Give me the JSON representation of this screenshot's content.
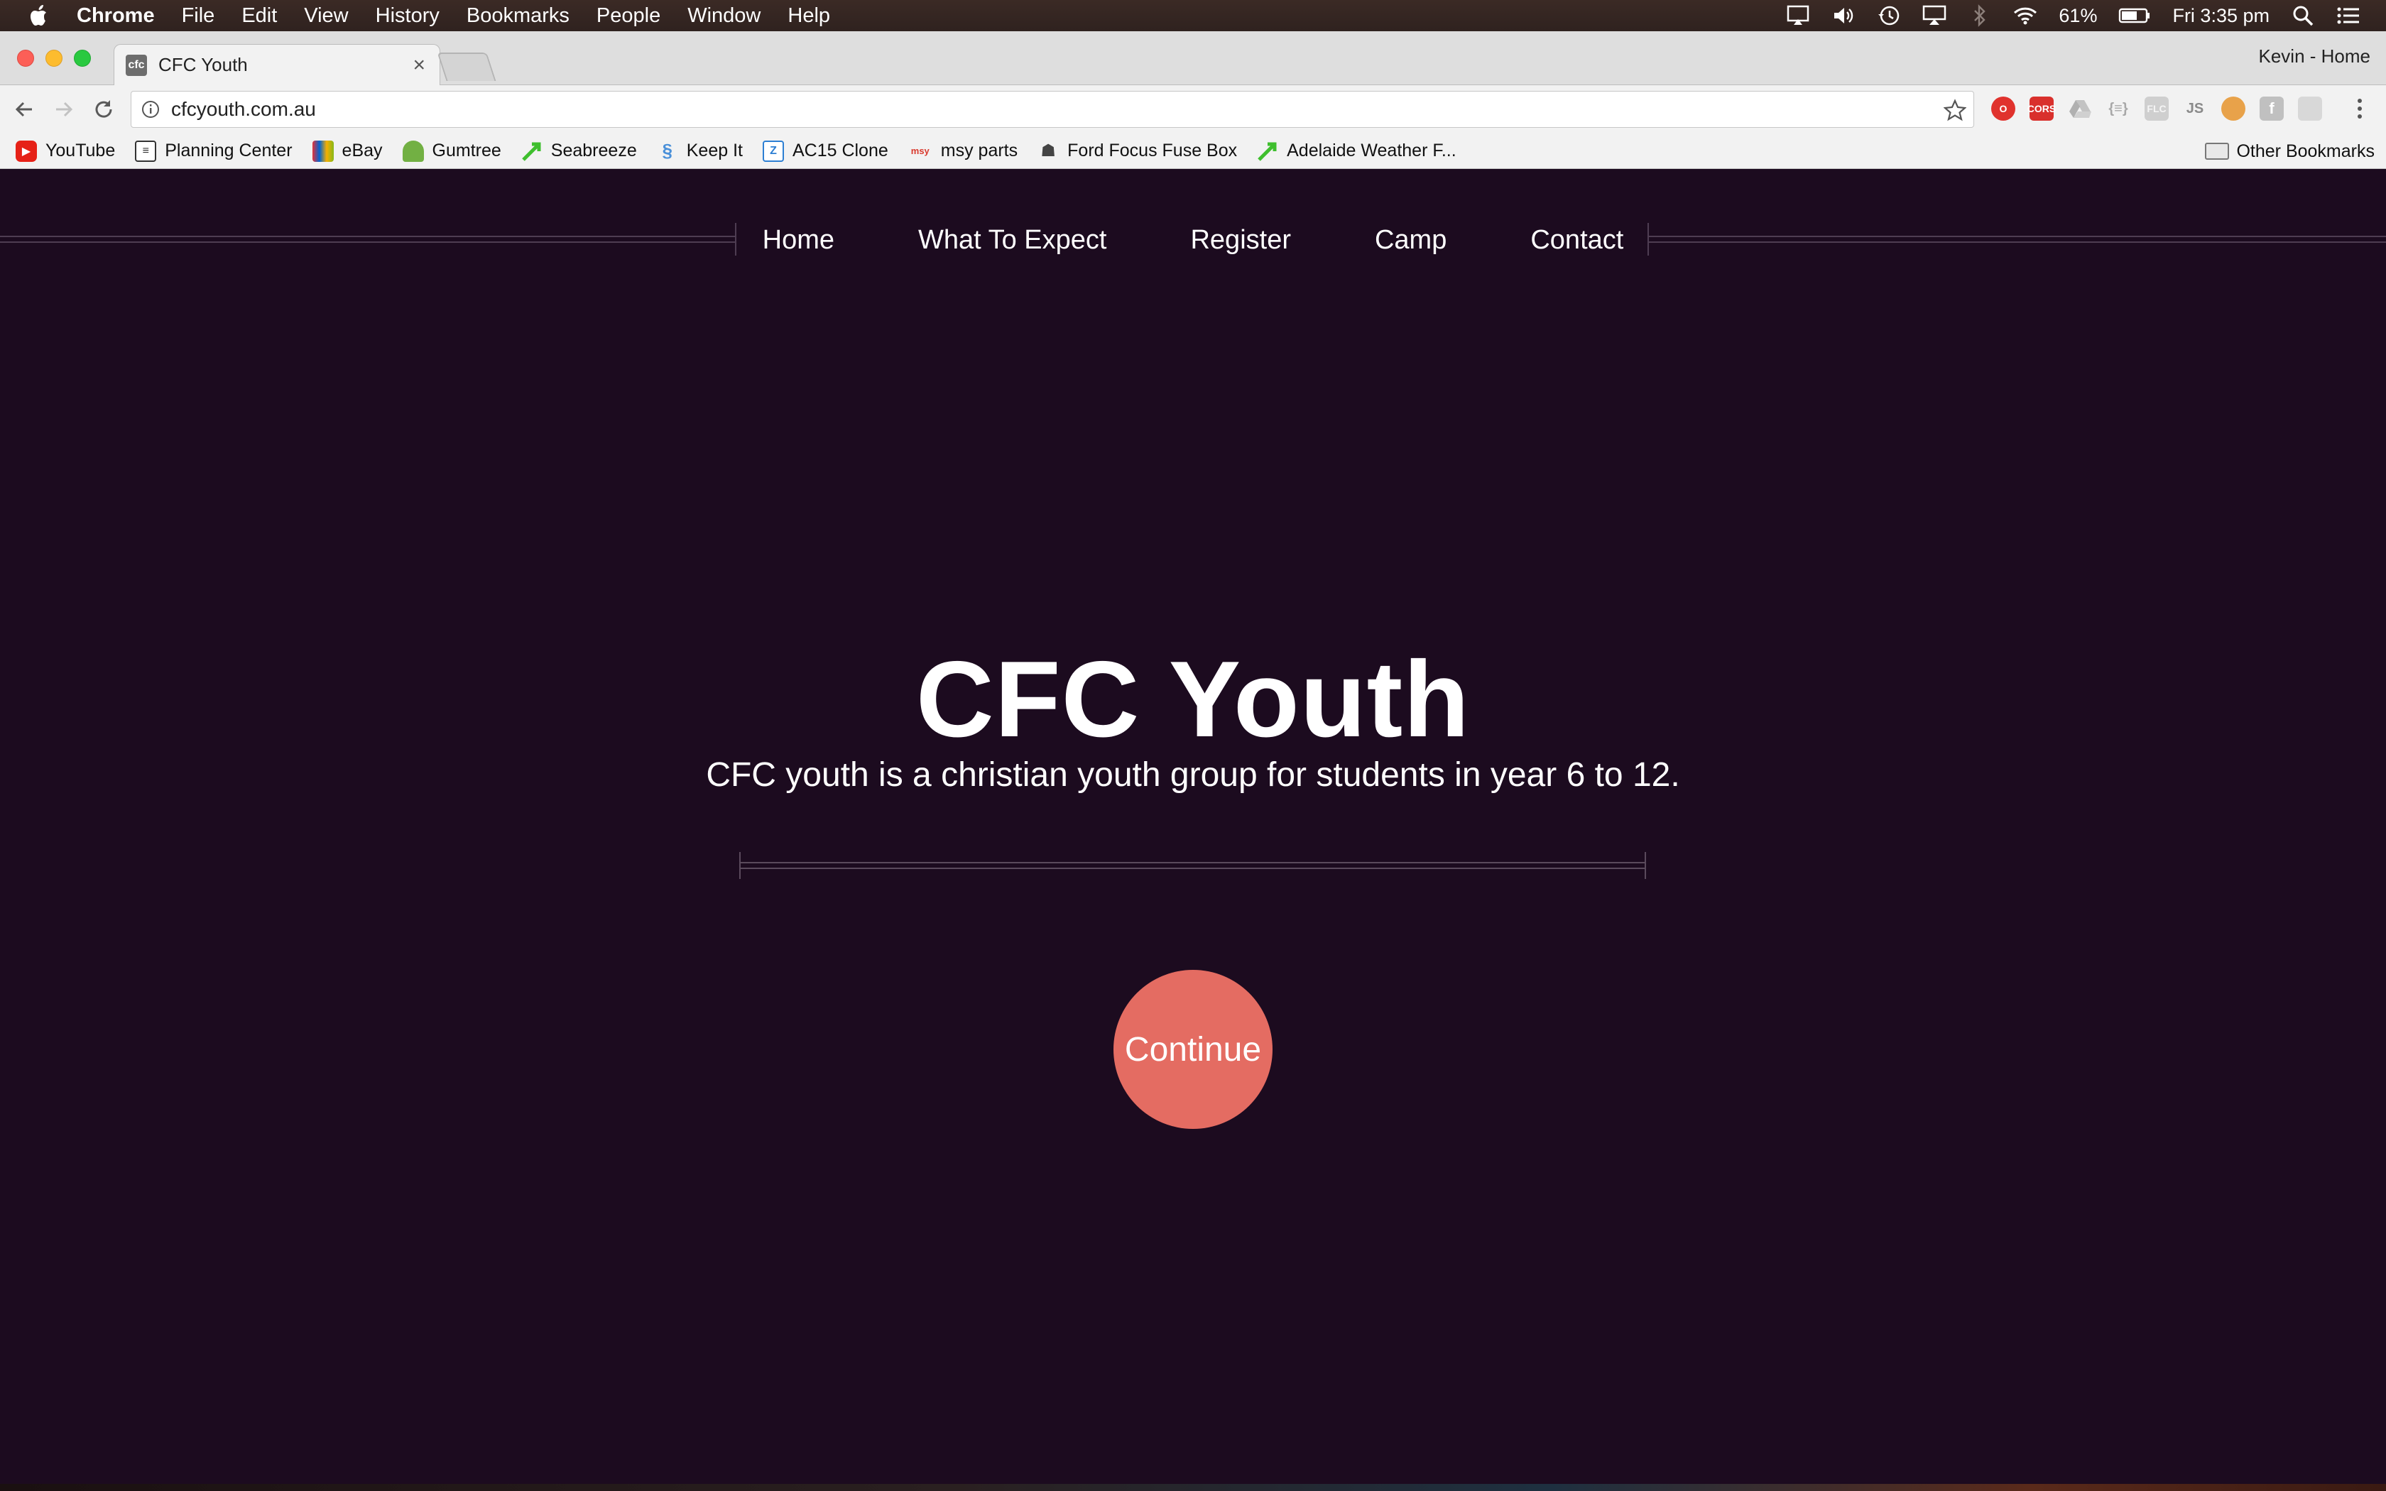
{
  "menubar": {
    "app_name": "Chrome",
    "items": [
      "File",
      "Edit",
      "View",
      "History",
      "Bookmarks",
      "People",
      "Window",
      "Help"
    ],
    "battery": "61%",
    "clock": "Fri 3:35 pm",
    "icons": [
      "airplay-mirror-icon",
      "volume-icon",
      "time-machine-icon",
      "airplay-icon",
      "bluetooth-icon",
      "wifi-icon",
      "battery-icon",
      "spotlight-icon",
      "notification-center-icon"
    ]
  },
  "browser": {
    "tab_title": "CFC Youth",
    "tab_favicon": "cfc",
    "profile_name": "Kevin - Home",
    "url": "cfcyouth.com.au",
    "extensions": [
      {
        "name": "opera-icon",
        "label": "",
        "color": "#e0322d"
      },
      {
        "name": "cors-icon",
        "label": "CORS",
        "color": "#d9302c"
      },
      {
        "name": "drive-icon",
        "label": "",
        "color": "#bdbdbd"
      },
      {
        "name": "json-icon",
        "label": "{≡}",
        "color": "#c9c9c9"
      },
      {
        "name": "flc-icon",
        "label": "FLC",
        "color": "#cfcfcf"
      },
      {
        "name": "js-icon",
        "label": "JS",
        "color": "#c8c8c8"
      },
      {
        "name": "cookie-icon",
        "label": "",
        "color": "#e8a24a"
      },
      {
        "name": "font-icon",
        "label": "f",
        "color": "#c0c0c0"
      },
      {
        "name": "grid-icon",
        "label": "",
        "color": "#d0d0d0"
      }
    ]
  },
  "bookmarks": {
    "items": [
      {
        "label": "YouTube",
        "icon": "youtube-icon",
        "color": "#e62117"
      },
      {
        "label": "Planning Center",
        "icon": "planning-center-icon",
        "color": "#333333"
      },
      {
        "label": "eBay",
        "icon": "ebay-icon",
        "color": "#2b6bd6"
      },
      {
        "label": "Gumtree",
        "icon": "gumtree-icon",
        "color": "#72b043"
      },
      {
        "label": "Seabreeze",
        "icon": "seabreeze-icon",
        "color": "#3fbf2e"
      },
      {
        "label": "Keep It",
        "icon": "keep-it-icon",
        "color": "#4a90d9"
      },
      {
        "label": "AC15 Clone",
        "icon": "ac15-icon",
        "color": "#2d7fd3"
      },
      {
        "label": "msy parts",
        "icon": "msy-icon",
        "color": "#d93a2e"
      },
      {
        "label": "Ford Focus Fuse Box",
        "icon": "fuse-box-icon",
        "color": "#444444"
      },
      {
        "label": "Adelaide Weather F...",
        "icon": "weather-icon",
        "color": "#3fbf2e"
      }
    ],
    "other_label": "Other Bookmarks"
  },
  "site": {
    "nav": [
      "Home",
      "What To Expect",
      "Register",
      "Camp",
      "Contact"
    ],
    "title": "CFC Youth",
    "subtitle": "CFC youth is a christian youth group for students in year 6 to 12.",
    "cta": "Continue",
    "colors": {
      "background": "#1c0b1f",
      "accent": "#e46c62",
      "rule": "#4e3d52"
    }
  }
}
